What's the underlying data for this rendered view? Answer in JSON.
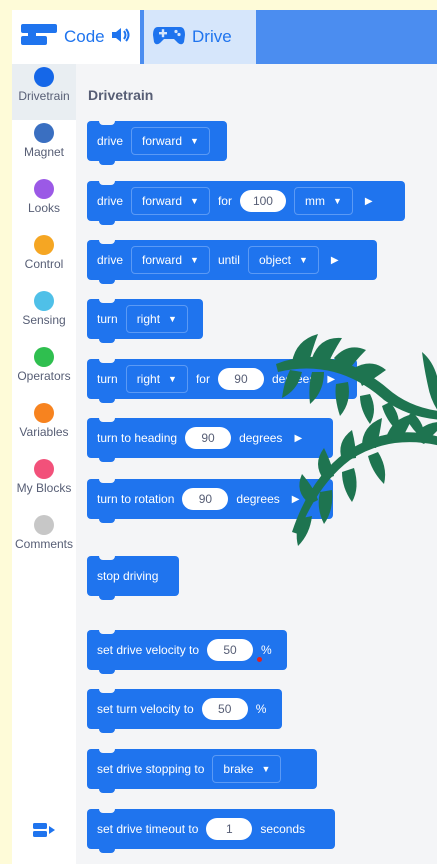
{
  "tabs": {
    "code": {
      "label": "Code",
      "icon": "code-blocks-icon"
    },
    "sound_icon": "speaker-icon",
    "drive": {
      "label": "Drive",
      "icon": "gamepad-icon"
    }
  },
  "colors": {
    "block_blue": "#1f74ee",
    "tab_bar": "#4b8df0",
    "page_background": "#fefbd8",
    "palm": "#1e7450"
  },
  "categories": [
    {
      "label": "Drivetrain",
      "color": "#1567e8"
    },
    {
      "label": "Magnet",
      "color": "#3a6fc1"
    },
    {
      "label": "Looks",
      "color": "#9b59e6"
    },
    {
      "label": "Control",
      "color": "#f5a623"
    },
    {
      "label": "Sensing",
      "color": "#4fc0e8"
    },
    {
      "label": "Operators",
      "color": "#2fbf4f"
    },
    {
      "label": "Variables",
      "color": "#f7831f"
    },
    {
      "label": "My Blocks",
      "color": "#f2517a"
    },
    {
      "label": "Comments",
      "color": "#c7c7c7"
    }
  ],
  "palette": {
    "title": "Drivetrain",
    "blocks": {
      "drive": {
        "t1": "drive",
        "dir": "forward"
      },
      "drive_for": {
        "t1": "drive",
        "dir": "forward",
        "t2": "for",
        "value": "100",
        "unit": "mm"
      },
      "drive_until": {
        "t1": "drive",
        "dir": "forward",
        "t2": "until",
        "target": "object"
      },
      "turn": {
        "t1": "turn",
        "dir": "right"
      },
      "turn_for": {
        "t1": "turn",
        "dir": "right",
        "t2": "for",
        "value": "90",
        "unit": "degrees"
      },
      "turn_heading": {
        "t1": "turn to heading",
        "value": "90",
        "unit": "degrees"
      },
      "turn_rotation": {
        "t1": "turn to rotation",
        "value": "90",
        "unit": "degrees"
      },
      "stop": {
        "t1": "stop driving"
      },
      "drive_velocity": {
        "t1": "set drive velocity to",
        "value": "50",
        "unit": "%"
      },
      "turn_velocity": {
        "t1": "set turn velocity to",
        "value": "50",
        "unit": "%"
      },
      "stopping": {
        "t1": "set drive stopping to",
        "mode": "brake"
      },
      "timeout": {
        "t1": "set drive timeout to",
        "value": "1",
        "unit": "seconds"
      }
    }
  }
}
